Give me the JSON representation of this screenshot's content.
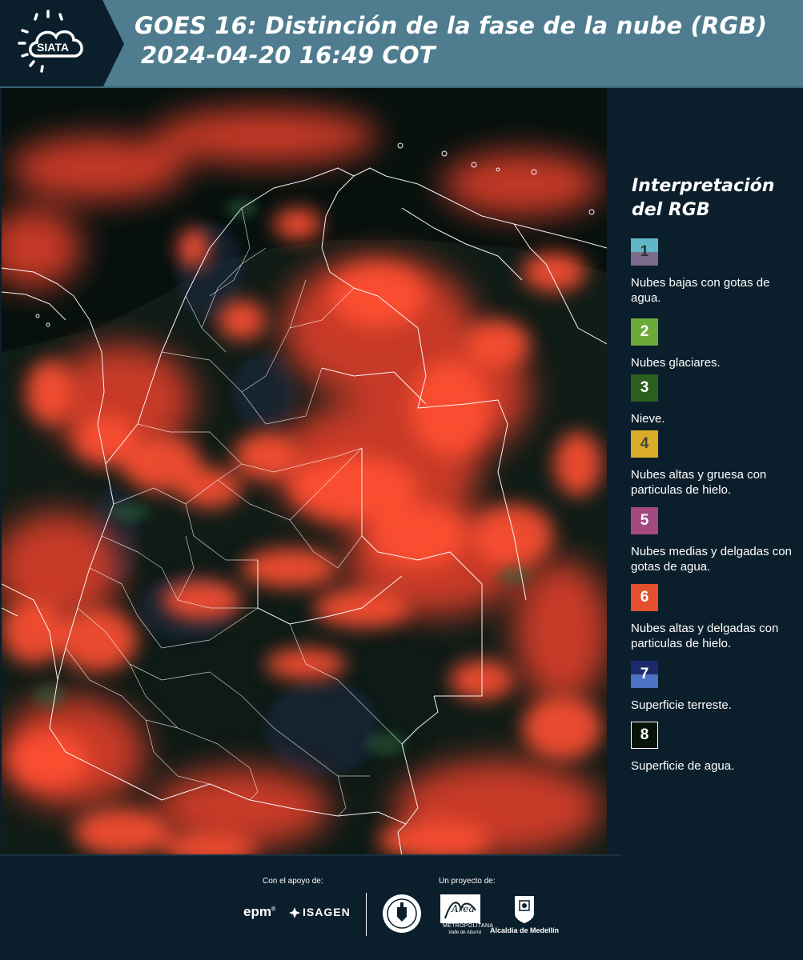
{
  "header": {
    "logo_text": "SIATA",
    "title_line1": "GOES 16: Distinción de la fase de la nube (RGB)",
    "title_line2": "2024-04-20 16:49 COT"
  },
  "legend": {
    "title_line1": "Interpretación",
    "title_line2": "del RGB",
    "items": [
      {
        "number": "1",
        "label": "Nubes bajas con gotas de agua.",
        "color_top": "#5fb7c7",
        "color_bottom": "#7b6b8c",
        "num_color": "#333333"
      },
      {
        "number": "2",
        "label": "Nubes glaciares.",
        "color_top": "#6cab3a",
        "color_bottom": "#6cab3a",
        "num_color": "#ffffff"
      },
      {
        "number": "3",
        "label": "Nieve.",
        "color_top": "#2c5f1f",
        "color_bottom": "#2c5f1f",
        "num_color": "#ffffff"
      },
      {
        "number": "4",
        "label": "Nubes altas y gruesa con particulas de hielo.",
        "color_top": "#d9ad2a",
        "color_bottom": "#d9ad2a",
        "num_color": "#444444"
      },
      {
        "number": "5",
        "label": "Nubes medias y delgadas con gotas de agua.",
        "color_top": "#a3497f",
        "color_bottom": "#a3497f",
        "num_color": "#ffffff"
      },
      {
        "number": "6",
        "label": "Nubes altas y delgadas con particulas de hielo.",
        "color_top": "#e4502d",
        "color_bottom": "#e4502d",
        "num_color": "#ffffff"
      },
      {
        "number": "7",
        "label": "Superficie terreste.",
        "color_top": "#1a2a6b",
        "color_bottom": "#4d72c2",
        "num_color": "#ffffff"
      },
      {
        "number": "8",
        "label": "Superficie de agua.",
        "color_top": "#071407",
        "color_bottom": "#071407",
        "num_color": "#ffffff"
      }
    ]
  },
  "footer": {
    "support_label": "Con el apoyo de:",
    "project_label": "Un proyecto de:",
    "sponsor_1": "epm",
    "sponsor_2": "ISAGEN",
    "area_text_1": "METROPOLITANA",
    "area_text_2": "Valle de Aburrá",
    "medellin_text": "Alcaldía de Medellín"
  },
  "colors": {
    "header_bg": "#4f7d8f",
    "panel_bg": "#0b1e2b",
    "cloud_red": "#f0442c",
    "border_white": "#ffffff"
  }
}
